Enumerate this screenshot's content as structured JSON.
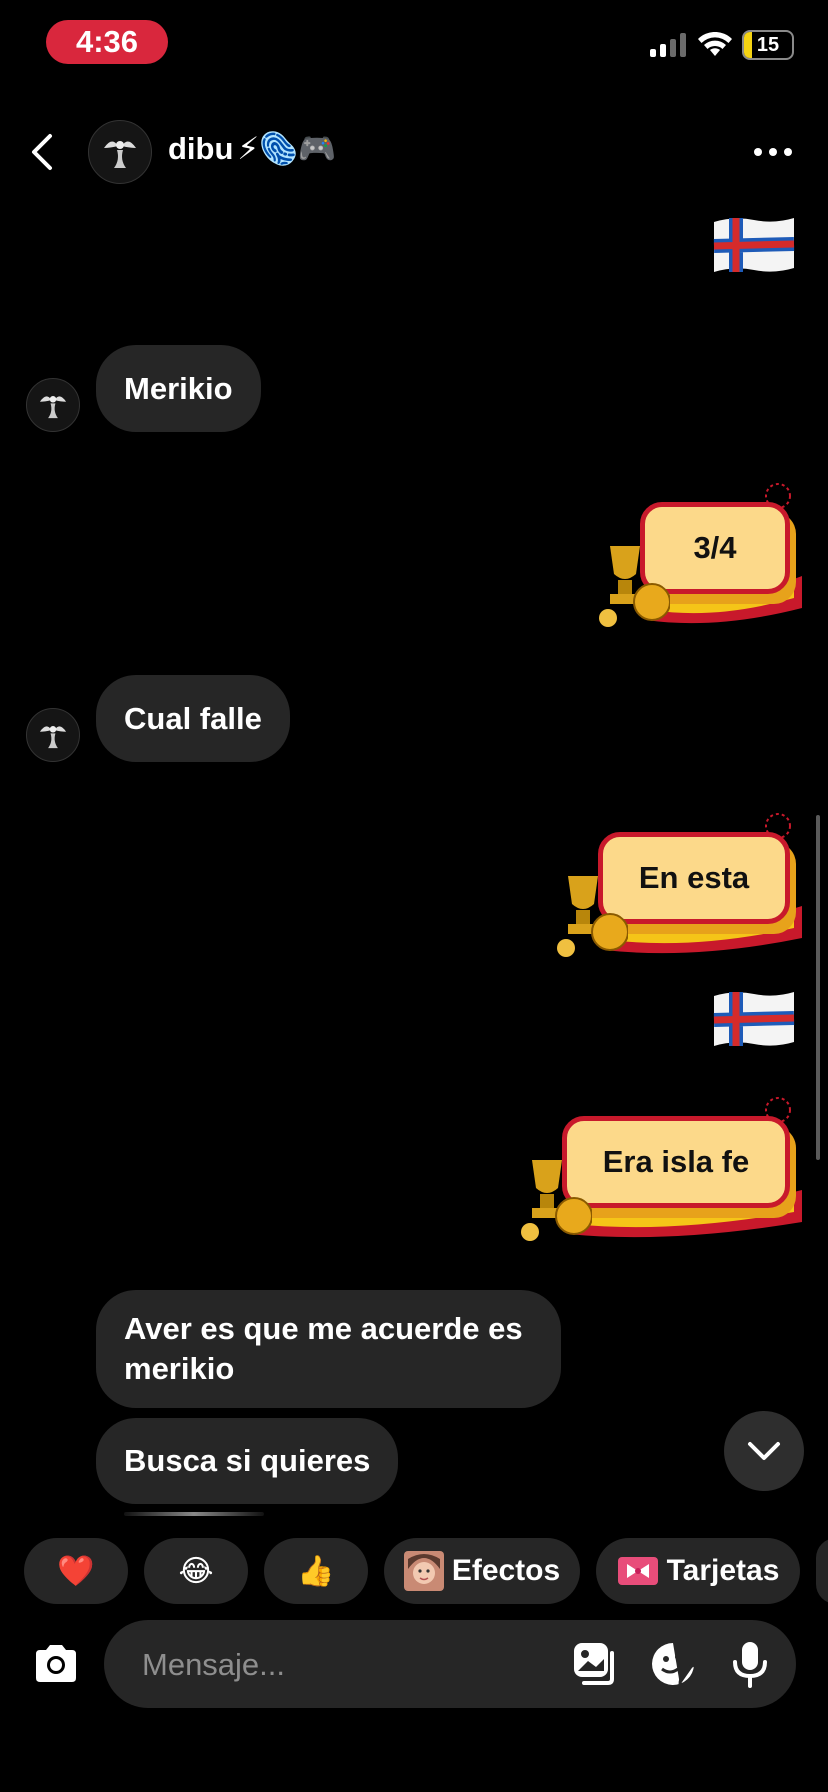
{
  "status_bar": {
    "time": "4:36",
    "battery": "15"
  },
  "header": {
    "contact_name": "dibu",
    "name_emojis": "⚡🫆🎮"
  },
  "messages": {
    "m1": "Merikio",
    "m2": "3/4",
    "m3": "Cual falle",
    "m4": "En esta",
    "m5": "Era isla fe",
    "m6": "Aver es que me acuerde es merikio",
    "m7": "Busca si quieres"
  },
  "quick_reactions": {
    "heart": "❤️",
    "laugh": "😂",
    "thumbs": "👍",
    "effects_label": "Efectos",
    "cards_label": "Tarjetas"
  },
  "composer": {
    "placeholder": "Mensaje..."
  },
  "icons": [
    "back-arrow-icon",
    "more-icon",
    "chevron-down-icon",
    "camera-icon",
    "gallery-icon",
    "sticker-icon",
    "microphone-icon"
  ],
  "colors": {
    "background": "#000000",
    "incoming_bubble": "#262626",
    "time_pill": "#d9273d",
    "sticker_plate": "#fcd98a",
    "sticker_border": "#c8192b"
  }
}
